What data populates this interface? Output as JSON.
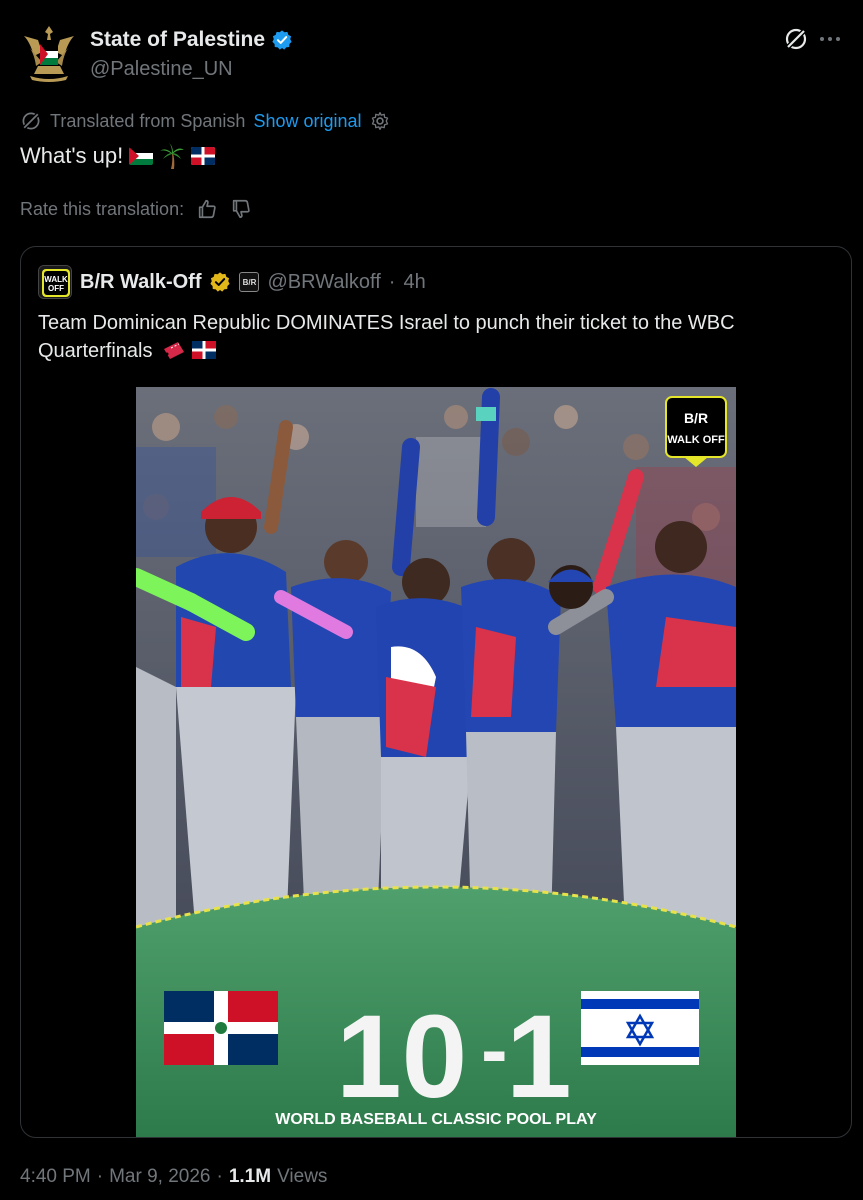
{
  "post": {
    "author_name": "State of Palestine",
    "author_handle": "@Palestine_UN",
    "translated_label": "Translated from Spanish",
    "show_original_label": "Show original",
    "text": "What's up!",
    "rate_label": "Rate this translation:"
  },
  "quoted": {
    "name": "B/R Walk-Off",
    "logo_text": "WALK OFF",
    "badge_text": "B/R",
    "handle": "@BRWalkoff",
    "separator": "·",
    "time": "4h",
    "text": "Team Dominican Republic DOMINATES Israel to punch their ticket to the WBC Quarterfinals",
    "media": {
      "watermark": "WALK OFF",
      "watermark_sub": "B/R",
      "score_left": "10",
      "score_dash": "-",
      "score_right": "1",
      "caption": "WORLD BASEBALL CLASSIC POOL PLAY"
    }
  },
  "footer": {
    "time": "4:40 PM",
    "sep1": "·",
    "date": "Mar 9, 2026",
    "sep2": "·",
    "views_count": "1.1M",
    "views_label": "Views"
  },
  "colors": {
    "accent": "#1d9bf0",
    "muted": "#71767b",
    "text": "#e7e9ea",
    "border": "#2f3336",
    "field_green": "#3a8f5c",
    "dr_blue": "#1c3f94",
    "dr_red": "#c8102e",
    "israel_blue": "#0038b8"
  },
  "icons": [
    "verified-badge-icon",
    "grok-icon",
    "more-icon",
    "translate-icon",
    "gear-icon",
    "thumbs-up-icon",
    "thumbs-down-icon"
  ]
}
